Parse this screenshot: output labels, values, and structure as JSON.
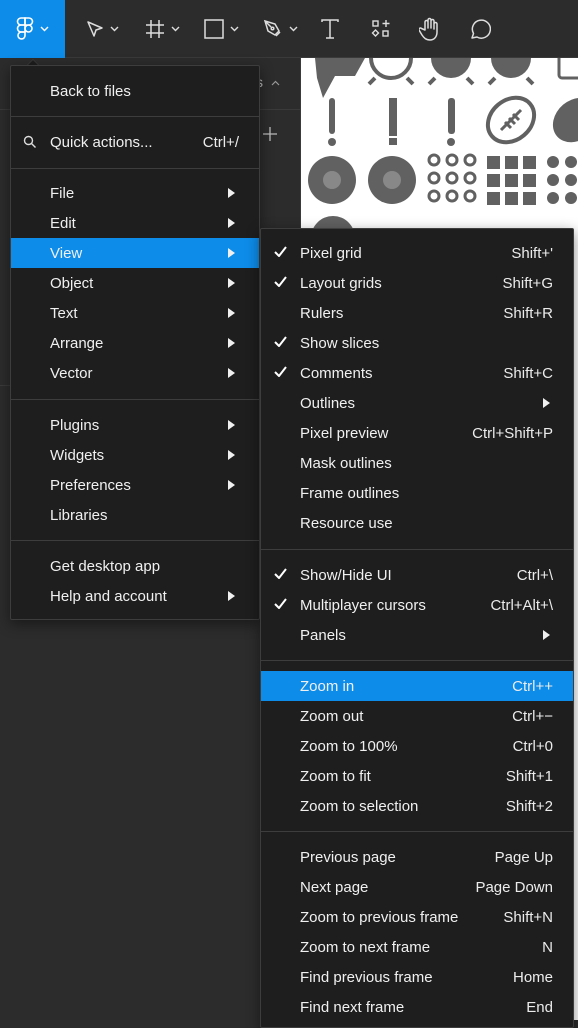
{
  "toolbar": {
    "accent_color": "#0d8ce9",
    "tools": [
      {
        "name": "main-menu",
        "icon": "figma-logo-icon",
        "has_dropdown": true
      },
      {
        "name": "move",
        "icon": "move-cursor-icon",
        "has_dropdown": true
      },
      {
        "name": "frame",
        "icon": "frame-hash-icon",
        "has_dropdown": true
      },
      {
        "name": "shape",
        "icon": "rectangle-icon",
        "has_dropdown": true
      },
      {
        "name": "pen",
        "icon": "pen-icon",
        "has_dropdown": true
      },
      {
        "name": "text",
        "icon": "text-icon",
        "has_dropdown": false
      },
      {
        "name": "resources",
        "icon": "resources-icon",
        "has_dropdown": false
      },
      {
        "name": "hand",
        "icon": "hand-icon",
        "has_dropdown": false
      },
      {
        "name": "comment",
        "icon": "comment-icon",
        "has_dropdown": false
      }
    ]
  },
  "left_panel": {
    "partial_label": "s"
  },
  "main_menu": {
    "items": [
      {
        "label": "Back to files"
      },
      {
        "label": "Quick actions...",
        "shortcut": "Ctrl+/",
        "icon": "search-icon"
      },
      {
        "label": "File",
        "submenu": true
      },
      {
        "label": "Edit",
        "submenu": true
      },
      {
        "label": "View",
        "submenu": true,
        "active": true
      },
      {
        "label": "Object",
        "submenu": true
      },
      {
        "label": "Text",
        "submenu": true
      },
      {
        "label": "Arrange",
        "submenu": true
      },
      {
        "label": "Vector",
        "submenu": true
      },
      {
        "label": "Plugins",
        "submenu": true
      },
      {
        "label": "Widgets",
        "submenu": true
      },
      {
        "label": "Preferences",
        "submenu": true
      },
      {
        "label": "Libraries"
      },
      {
        "label": "Get desktop app"
      },
      {
        "label": "Help and account",
        "submenu": true
      }
    ]
  },
  "view_menu": {
    "items": [
      {
        "label": "Pixel grid",
        "shortcut": "Shift+'",
        "checked": true
      },
      {
        "label": "Layout grids",
        "shortcut": "Shift+G",
        "checked": true
      },
      {
        "label": "Rulers",
        "shortcut": "Shift+R",
        "checked": false
      },
      {
        "label": "Show slices",
        "shortcut": "",
        "checked": true
      },
      {
        "label": "Comments",
        "shortcut": "Shift+C",
        "checked": true
      },
      {
        "label": "Outlines",
        "submenu": true
      },
      {
        "label": "Pixel preview",
        "shortcut": "Ctrl+Shift+P"
      },
      {
        "label": "Mask outlines",
        "shortcut": ""
      },
      {
        "label": "Frame outlines",
        "shortcut": ""
      },
      {
        "label": "Resource use",
        "shortcut": ""
      },
      {
        "label": "Show/Hide UI",
        "shortcut": "Ctrl+\\",
        "checked": true
      },
      {
        "label": "Multiplayer cursors",
        "shortcut": "Ctrl+Alt+\\",
        "checked": true
      },
      {
        "label": "Panels",
        "submenu": true
      },
      {
        "label": "Zoom in",
        "shortcut": "Ctrl++",
        "active": true
      },
      {
        "label": "Zoom out",
        "shortcut": "Ctrl+−"
      },
      {
        "label": "Zoom to 100%",
        "shortcut": "Ctrl+0"
      },
      {
        "label": "Zoom to fit",
        "shortcut": "Shift+1"
      },
      {
        "label": "Zoom to selection",
        "shortcut": "Shift+2"
      },
      {
        "label": "Previous page",
        "shortcut": "Page Up"
      },
      {
        "label": "Next page",
        "shortcut": "Page Down"
      },
      {
        "label": "Zoom to previous frame",
        "shortcut": "Shift+N"
      },
      {
        "label": "Zoom to next frame",
        "shortcut": "N"
      },
      {
        "label": "Find previous frame",
        "shortcut": "Home"
      },
      {
        "label": "Find next frame",
        "shortcut": "End"
      }
    ]
  }
}
